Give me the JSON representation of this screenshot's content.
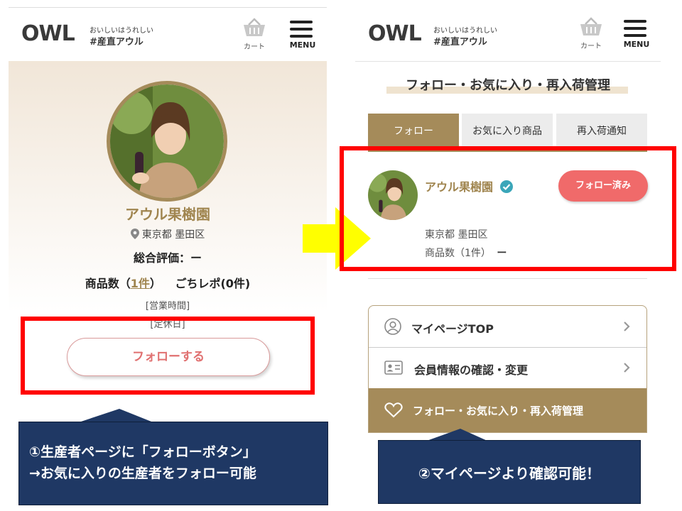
{
  "left": {
    "header": {
      "logo": "OWL",
      "tagline_small": "おいしいはうれしい",
      "tagline_big": "#産直アウル",
      "cart_label": "カート",
      "menu_label": "MENU"
    },
    "producer": {
      "name": "アウル果樹園",
      "location": "東京都 墨田区",
      "rating_label": "総合評価：ー",
      "products_prefix": "商品数（",
      "products_link": "1件",
      "products_suffix": "）",
      "gochi_repo": "ごちレポ(0件)",
      "hours_label": "[営業時間]",
      "holiday_label": "[定休日]",
      "follow_button": "フォローする"
    }
  },
  "arrow_color": "#ffff00",
  "right": {
    "header": {
      "logo": "OWL",
      "tagline_small": "おいしいはうれしい",
      "tagline_big": "#産直アウル",
      "cart_label": "カート",
      "menu_label": "MENU"
    },
    "page_title": "フォロー・お気に入り・再入荷管理",
    "tabs": [
      {
        "label": "フォロー",
        "active": true
      },
      {
        "label": "お気に入り商品",
        "active": false
      },
      {
        "label": "再入荷通知",
        "active": false
      }
    ],
    "followed_producer": {
      "name": "アウル果樹園",
      "location": "東京都 墨田区",
      "products": "商品数（1件）",
      "products_dash": "ー",
      "followed_button": "フォロー済み"
    },
    "mypage_menu": [
      {
        "label": "マイページTOP",
        "icon": "person-icon"
      },
      {
        "label": "会員情報の確認・変更",
        "icon": "id-card-icon"
      },
      {
        "label": "フォロー・お気に入り・再入荷管理",
        "icon": "heart-icon"
      }
    ]
  },
  "callouts": {
    "left_line1": "①生産者ページに「フォローボタン」",
    "left_line2": "→お気に入りの生産者をフォロー可能",
    "right": "②マイページより確認可能！"
  },
  "colors": {
    "accent_gold": "#a58b5a",
    "highlight_red": "#ff0000",
    "follow_pink": "#f06a6a",
    "callout_navy": "#1f3864"
  }
}
